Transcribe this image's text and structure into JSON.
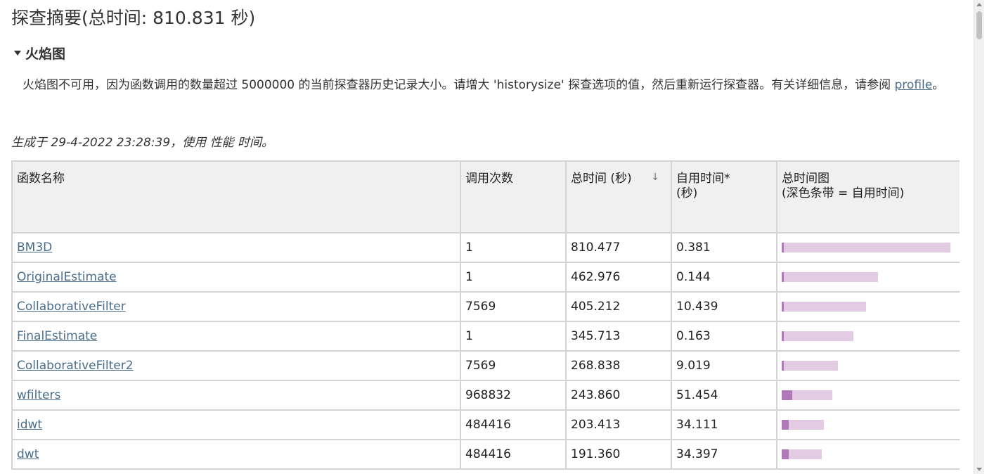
{
  "header": {
    "title": "探查摘要(总时间: 810.831 秒)"
  },
  "flame": {
    "section_title": "火焰图",
    "notice_text": "火焰图不可用，因为函数调用的数量超过 5000000 的当前探查器历史记录大小。请增大 'historysize' 探查选项的值，然后重新运行探查器。有关详细信息，请参阅 ",
    "notice_link": "profile",
    "notice_end": "。"
  },
  "generated_text": "生成于 29-4-2022 23:28:39，使用 性能 时间。",
  "table": {
    "headers": {
      "fn": "函数名称",
      "calls": "调用次数",
      "total": "总时间 (秒)",
      "sort_icon": "↓",
      "self_line1": "自用时间*",
      "self_line2": "(秒)",
      "graph_line1": "总时间图",
      "graph_line2": "(深色条带 = 自用时间)"
    },
    "max_total": 810.477,
    "rows": [
      {
        "name": "BM3D",
        "calls": "1",
        "total": "810.477",
        "self": "0.381",
        "total_val": 810.477,
        "self_val": 0.381
      },
      {
        "name": "OriginalEstimate",
        "calls": "1",
        "total": "462.976",
        "self": "0.144",
        "total_val": 462.976,
        "self_val": 0.144
      },
      {
        "name": "CollaborativeFilter",
        "calls": "7569",
        "total": "405.212",
        "self": "10.439",
        "total_val": 405.212,
        "self_val": 10.439
      },
      {
        "name": "FinalEstimate",
        "calls": "1",
        "total": "345.713",
        "self": "0.163",
        "total_val": 345.713,
        "self_val": 0.163
      },
      {
        "name": "CollaborativeFilter2",
        "calls": "7569",
        "total": "268.838",
        "self": "9.019",
        "total_val": 268.838,
        "self_val": 9.019
      },
      {
        "name": "wfilters",
        "calls": "968832",
        "total": "243.860",
        "self": "51.454",
        "total_val": 243.86,
        "self_val": 51.454
      },
      {
        "name": "idwt",
        "calls": "484416",
        "total": "203.413",
        "self": "34.111",
        "total_val": 203.413,
        "self_val": 34.111
      },
      {
        "name": "dwt",
        "calls": "484416",
        "total": "191.360",
        "self": "34.397",
        "total_val": 191.36,
        "self_val": 34.397
      }
    ]
  },
  "colors": {
    "bar_total": "#e3cbe3",
    "bar_self": "#b078b8",
    "link": "#4a6d8c"
  }
}
